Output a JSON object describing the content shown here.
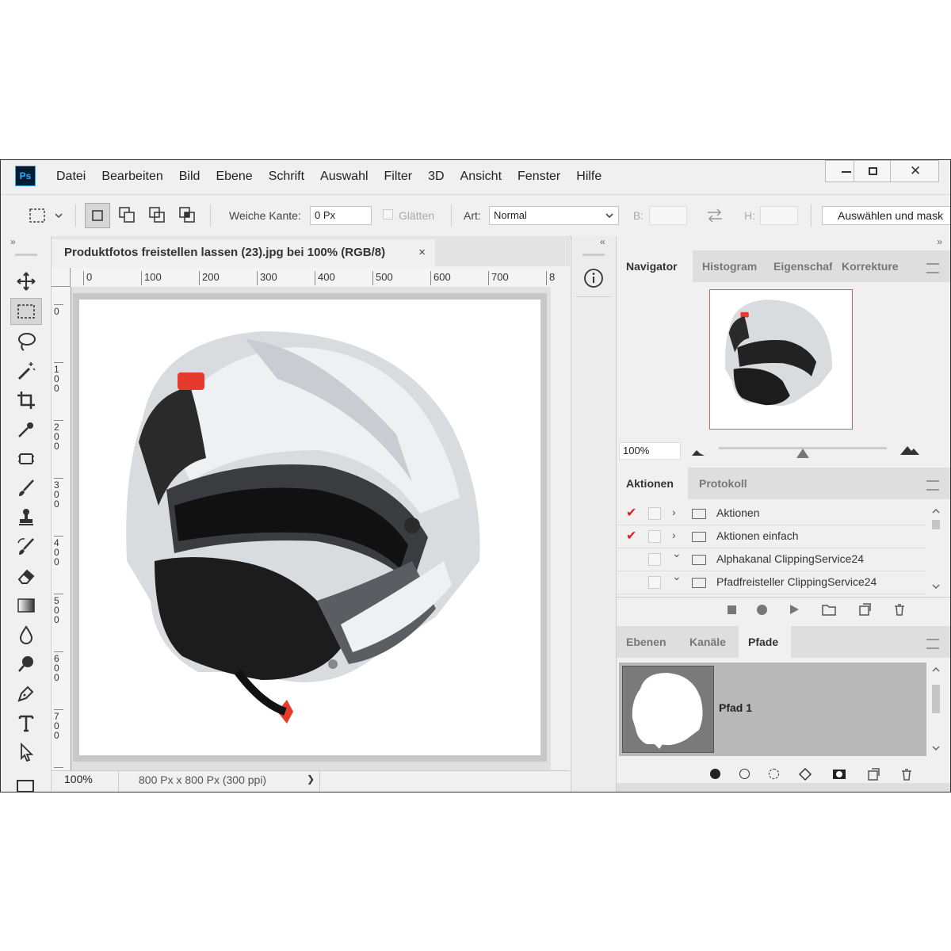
{
  "app": {
    "logo": "Ps",
    "menu": [
      "Datei",
      "Bearbeiten",
      "Bild",
      "Ebene",
      "Schrift",
      "Auswahl",
      "Filter",
      "3D",
      "Ansicht",
      "Fenster",
      "Hilfe"
    ],
    "window_buttons": {
      "minimize": "–",
      "maximize": "□",
      "close": "✕"
    }
  },
  "options_bar": {
    "feather_label": "Weiche Kante:",
    "feather_value": "0 Px",
    "antialias_label": "Glätten",
    "style_label": "Art:",
    "style_value": "Normal",
    "width_label": "B:",
    "height_label": "H:",
    "select_mask_label": "Auswählen und mask"
  },
  "document": {
    "tab_title": "Produktfotos freistellen lassen (23).jpg bei 100% (RGB/8)",
    "close": "×",
    "ruler_top": [
      "0",
      "100",
      "200",
      "300",
      "400",
      "500",
      "600",
      "700",
      "8"
    ],
    "ruler_left": [
      "0",
      "100",
      "200",
      "300",
      "400",
      "500",
      "600",
      "700",
      "8"
    ],
    "zoom": "100%",
    "doc_info": "800 Px x 800 Px (300 ppi)",
    "status_arrow": "❯"
  },
  "collapse": {
    "left": "»",
    "mid": "«",
    "right": "»"
  },
  "navigator": {
    "tabs": [
      "Navigator",
      "Histogram",
      "Eigenschaf",
      "Korrekture"
    ],
    "active_tab": 0,
    "zoom_value": "100%",
    "zoom_level": 0.5
  },
  "actions": {
    "tabs": [
      "Aktionen",
      "Protokoll"
    ],
    "active_tab": 0,
    "items": [
      {
        "label": "Aktionen",
        "checked": true,
        "expanded": false
      },
      {
        "label": "Aktionen einfach",
        "checked": true,
        "expanded": false
      },
      {
        "label": "Alphakanal ClippingService24",
        "checked": false,
        "expanded": true
      },
      {
        "label": "Pfadfreisteller ClippingService24",
        "checked": false,
        "expanded": true
      }
    ]
  },
  "layers": {
    "tabs": [
      "Ebenen",
      "Kanäle",
      "Pfade"
    ],
    "active_tab": 2,
    "path_name": "Pfad 1"
  },
  "colors": {
    "accent_red": "#e02020",
    "ps_blue": "#31a8ff",
    "ps_dark": "#001d34"
  }
}
